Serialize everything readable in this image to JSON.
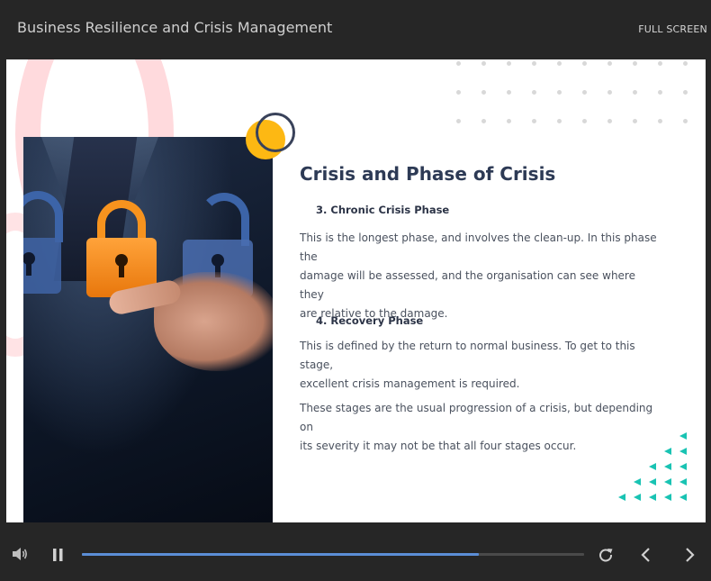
{
  "header": {
    "course_title": "Business Resilience and Crisis Management",
    "fullscreen_label": "FULL SCREEN"
  },
  "slide": {
    "heading": "Crisis and Phase of Crisis",
    "sections": [
      {
        "heading": "3. Chronic Crisis Phase",
        "text_lines": [
          "This is the longest phase, and involves the clean-up. In this phase the",
          "damage will be assessed, and the organisation can see where they",
          "are relative to the damage."
        ]
      },
      {
        "heading": "4. Recovery Phase",
        "text_lines": [
          "This is defined by the return to normal business. To get to this stage,",
          "excellent crisis management is required."
        ]
      }
    ],
    "closing_lines": [
      "These stages are the usual progression of a crisis, but depending on",
      "its severity it may not be that all four stages occur."
    ]
  },
  "player": {
    "progress_fraction": 0.79,
    "icons": [
      "volume-icon",
      "pause-icon",
      "replay-icon",
      "chevron-left-icon",
      "chevron-right-icon"
    ]
  },
  "colors": {
    "accent_blue": "#5b8ed6",
    "heading_navy": "#2d3a55",
    "accent_yellow": "#fdb813",
    "accent_teal": "#19c3b3",
    "accent_orange": "#f7931e"
  }
}
